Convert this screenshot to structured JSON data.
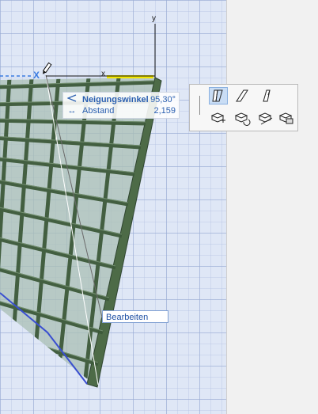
{
  "axes": {
    "x_label": "x",
    "y_label": "y",
    "origin_x_label": "X"
  },
  "info_box": {
    "angle_label": "Neigungswinkel",
    "angle_value": "95,30°",
    "distance_label": "Abstand",
    "distance_value": "2,159",
    "angle_icon": "angle-icon",
    "distance_icon": "arrows-horizontal-icon"
  },
  "palette": {
    "buttons": [
      {
        "name": "slant-wall-vertical-icon",
        "selected": true
      },
      {
        "name": "slant-wall-parallelogram-icon",
        "selected": false
      },
      {
        "name": "slant-wall-tilted-icon",
        "selected": false
      },
      {
        "name": "move-node-icon",
        "selected": false
      },
      {
        "name": "rotate-node-icon",
        "selected": false
      },
      {
        "name": "offset-edge-icon",
        "selected": false
      },
      {
        "name": "offset-all-icon",
        "selected": false
      }
    ]
  },
  "tooltip": {
    "text": "Bearbeiten"
  },
  "colors": {
    "viewport_bg": "#dfe7f6",
    "frame_green": "#3f5a3a",
    "glass": "#a9c0b3",
    "highlight_yellow": "#f2e600",
    "accent_blue": "#2a5fb0"
  }
}
